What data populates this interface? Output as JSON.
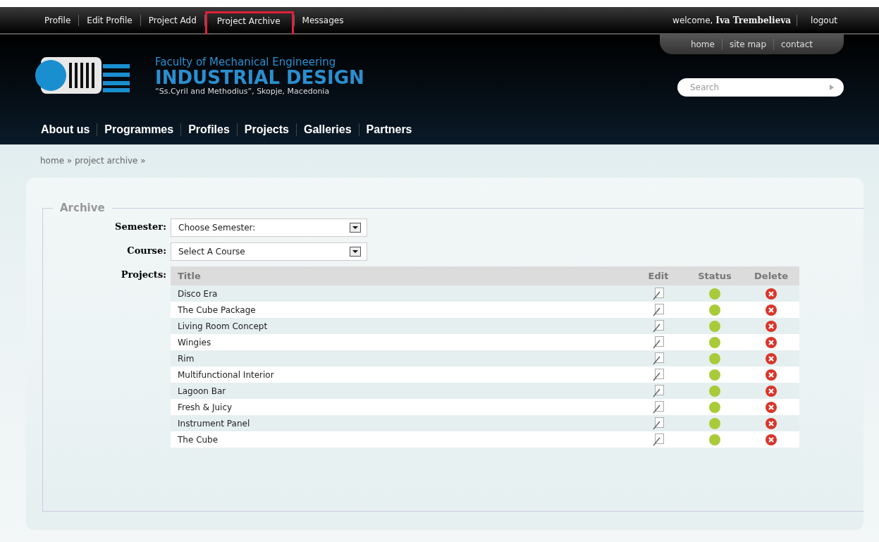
{
  "top_nav": [
    {
      "label": "Profile",
      "highlighted": false
    },
    {
      "label": "Edit Profile",
      "highlighted": false
    },
    {
      "label": "Project Add",
      "highlighted": false
    },
    {
      "label": "Project Archive",
      "highlighted": true
    },
    {
      "label": "Messages",
      "highlighted": false
    }
  ],
  "user": {
    "greeting": "welcome,",
    "name": "Iva Trembelieva",
    "logout": "logout"
  },
  "utility_links": [
    "home",
    "site map",
    "contact"
  ],
  "site": {
    "faculty": "Faculty of Mechanical Engineering",
    "department": "INDUSTRIAL DESIGN",
    "university": "“Ss.Cyril and Methodius”, Skopje, Macedonia"
  },
  "search": {
    "placeholder": "Search"
  },
  "main_nav": [
    "About us",
    "Programmes",
    "Profiles",
    "Projects",
    "Galleries",
    "Partners"
  ],
  "breadcrumb": "home » project archive »",
  "archive": {
    "legend": "Archive",
    "semester": {
      "label": "Semester:",
      "value": "Choose Semester:"
    },
    "course": {
      "label": "Course:",
      "value": "Select A Course"
    },
    "projects_label": "Projects:",
    "columns": [
      "Title",
      "Edit",
      "Status",
      "Delete"
    ],
    "rows": [
      {
        "title": "Disco Era",
        "color": "#a9cb3a"
      },
      {
        "title": "The Cube Package",
        "color": "#a9cb3a"
      },
      {
        "title": "Living Room Concept",
        "color": "#a9cb3a"
      },
      {
        "title": "Wingies",
        "color": "#a9cb3a"
      },
      {
        "title": "Rim",
        "color": "#a9cb3a"
      },
      {
        "title": "Multifunctional Interior",
        "color": "#a9cb3a"
      },
      {
        "title": "Lagoon Bar",
        "color": "#a9cb3a"
      },
      {
        "title": "Fresh & Juicy",
        "color": "#a9cb3a"
      },
      {
        "title": "Instrument Panel",
        "color": "#a9cb3a"
      },
      {
        "title": "The Cube",
        "color": "#a9cb3a"
      }
    ]
  }
}
